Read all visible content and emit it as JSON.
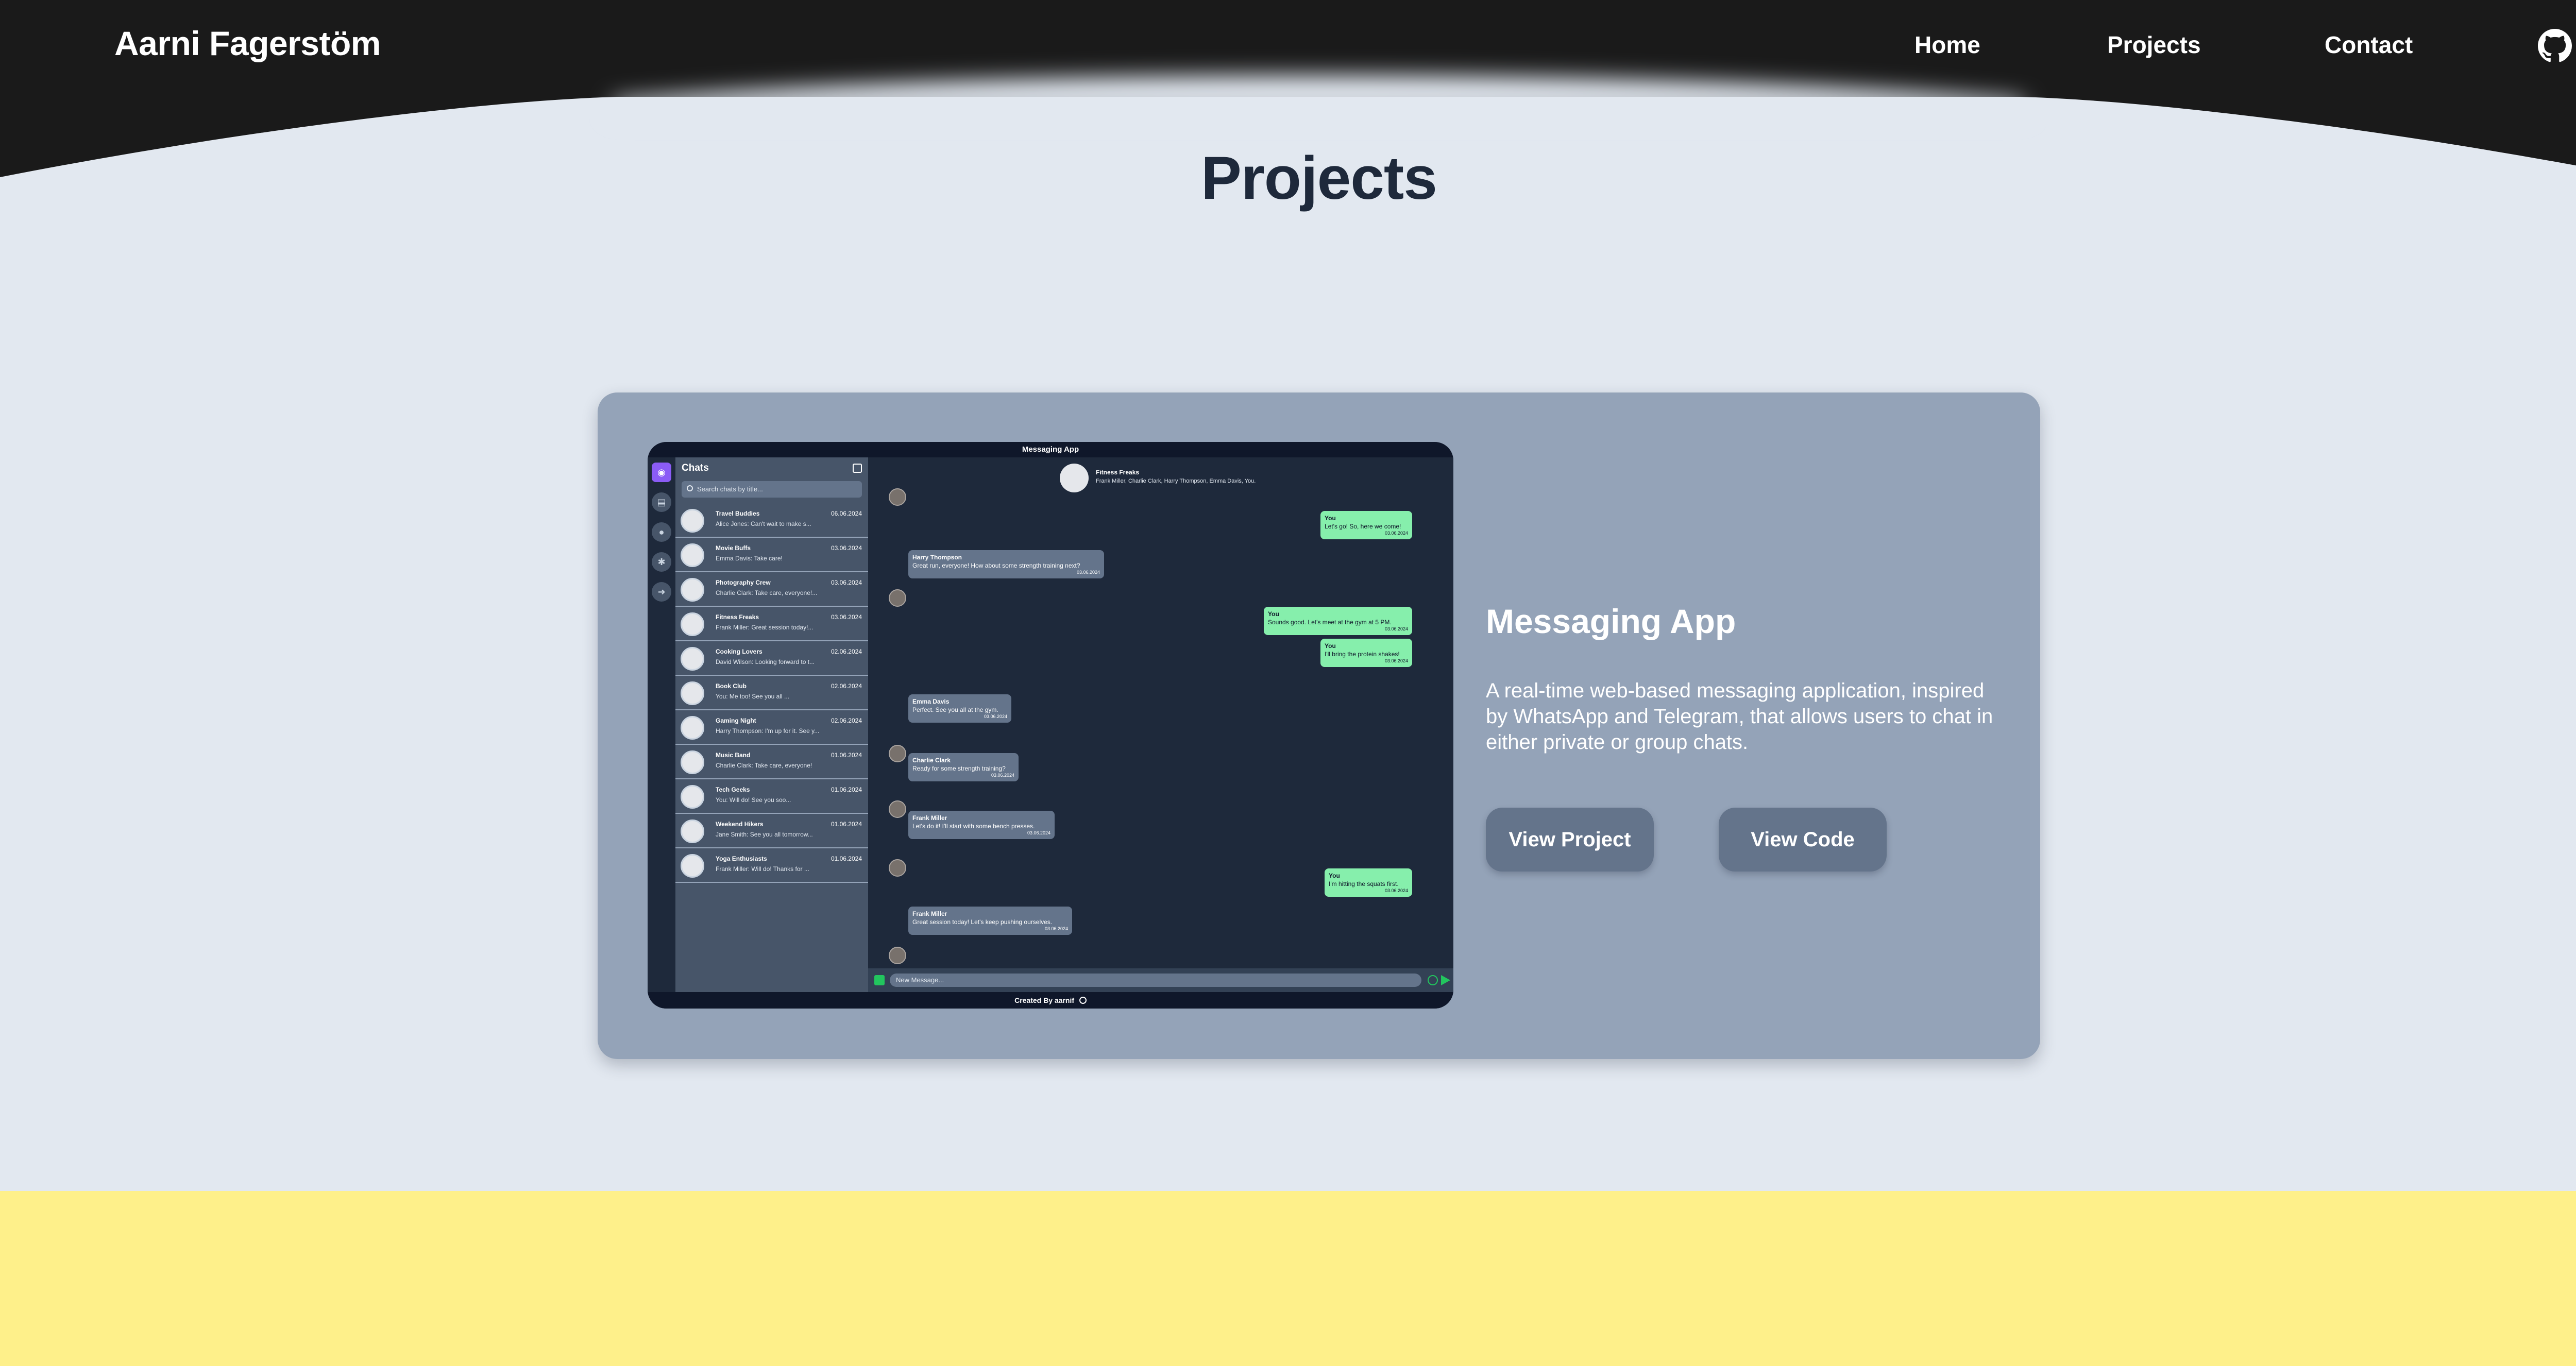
{
  "header": {
    "brand": "Aarni Fagerstöm",
    "nav": [
      {
        "label": "Home"
      },
      {
        "label": "Projects"
      },
      {
        "label": "Contact"
      }
    ],
    "github_icon": "github-icon"
  },
  "main": {
    "title": "Projects"
  },
  "project": {
    "name": "Messaging App",
    "description": "A real-time web-based messaging application, inspired by WhatsApp and Telegram, that allows users to chat in either private or group chats.",
    "buttons": {
      "view_project": "View Project",
      "view_code": "View Code"
    },
    "preview": {
      "app_title": "Messaging App",
      "chats_title": "Chats",
      "search_placeholder": "Search chats by title...",
      "chats": [
        {
          "name": "Travel Buddies",
          "date": "06.06.2024",
          "preview": "Alice Jones: Can't wait to make s..."
        },
        {
          "name": "Movie Buffs",
          "date": "03.06.2024",
          "preview": "Emma Davis: Take care!"
        },
        {
          "name": "Photography Crew",
          "date": "03.06.2024",
          "preview": "Charlie Clark: Take care, everyone!..."
        },
        {
          "name": "Fitness Freaks",
          "date": "03.06.2024",
          "preview": "Frank Miller: Great session today!..."
        },
        {
          "name": "Cooking Lovers",
          "date": "02.06.2024",
          "preview": "David Wilson: Looking forward to t..."
        },
        {
          "name": "Book Club",
          "date": "02.06.2024",
          "preview": "You: Me too! See you all ..."
        },
        {
          "name": "Gaming Night",
          "date": "02.06.2024",
          "preview": "Harry Thompson: I'm up for it. See y..."
        },
        {
          "name": "Music Band",
          "date": "01.06.2024",
          "preview": "Charlie Clark: Take care, everyone!"
        },
        {
          "name": "Tech Geeks",
          "date": "01.06.2024",
          "preview": "You: Will do! See you soo..."
        },
        {
          "name": "Weekend Hikers",
          "date": "01.06.2024",
          "preview": "Jane Smith: See you all tomorrow..."
        },
        {
          "name": "Yoga Enthusiasts",
          "date": "01.06.2024",
          "preview": "Frank Miller: Will do! Thanks for ..."
        }
      ],
      "active_chat": {
        "name": "Fitness Freaks",
        "members": "Frank Miller, Charlie Clark, Harry Thompson, Emma Davis, You."
      },
      "messages": [
        {
          "sender": "You",
          "text": "Let's go! So, here we come!",
          "time": "03.06.2024",
          "out": true
        },
        {
          "sender": "Harry Thompson",
          "text": "Great run, everyone! How about some strength training next?",
          "time": "03.06.2024",
          "out": false
        },
        {
          "sender": "You",
          "text": "Sounds good. Let's meet at the gym at 5 PM.",
          "time": "03.06.2024",
          "out": true
        },
        {
          "sender": "You",
          "text": "I'll bring the protein shakes!",
          "time": "03.06.2024",
          "out": true
        },
        {
          "sender": "Emma Davis",
          "text": "Perfect. See you all at the gym.",
          "time": "03.06.2024",
          "out": false
        },
        {
          "sender": "Charlie Clark",
          "text": "Ready for some strength training?",
          "time": "03.06.2024",
          "out": false
        },
        {
          "sender": "Frank Miller",
          "text": "Let's do it! I'll start with some bench presses.",
          "time": "03.06.2024",
          "out": false
        },
        {
          "sender": "You",
          "text": "I'm hitting the squats first.",
          "time": "03.06.2024",
          "out": true
        },
        {
          "sender": "Frank Miller",
          "text": "Great session today! Let's keep pushing ourselves.",
          "time": "03.06.2024",
          "out": false
        }
      ],
      "composer_placeholder": "New Message...",
      "footer": "Created By aarnif"
    }
  },
  "colors": {
    "header": "#1a1a1a",
    "page_bg": "#e2e8f0",
    "card_bg": "#94a3b8",
    "button_bg": "#64748b",
    "footer_band": "#fef08a",
    "title_text": "#1e293b"
  }
}
